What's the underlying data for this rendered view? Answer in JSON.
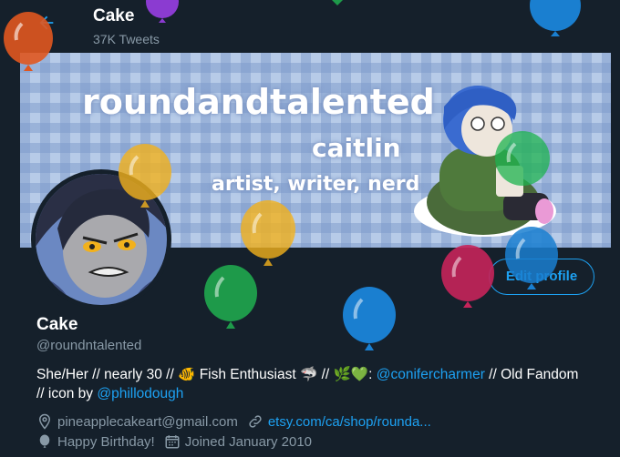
{
  "header": {
    "back_icon": "arrow-left-icon",
    "name": "Cake",
    "tweets": "37K Tweets"
  },
  "banner": {
    "title": "roundandtalented",
    "subtitle": "caitlin",
    "tagline": "artist, writer, nerd"
  },
  "profile": {
    "display_name": "Cake",
    "handle": "@roundntalented",
    "edit_button": "Edit profile",
    "bio": {
      "part1": "She/Her // nearly 30 // ",
      "fish_emoji": "🐠",
      "part2": " Fish Enthusiast ",
      "shark_emoji": "🦈",
      "part3": " // ",
      "herb_emoji": "🌿",
      "heart_emoji": "💚",
      "part4": ": ",
      "mention1": "@conifercharmer",
      "part5": " //  Old Fandom // icon by ",
      "mention2": "@phillodough"
    },
    "meta": {
      "email": "pineapplecakeart@gmail.com",
      "website": "etsy.com/ca/shop/rounda...",
      "birthday": "Happy Birthday!",
      "joined": "Joined January 2010"
    }
  },
  "colors": {
    "background": "#15202b",
    "accent": "#1da1f2",
    "secondary_text": "#8899a6"
  }
}
